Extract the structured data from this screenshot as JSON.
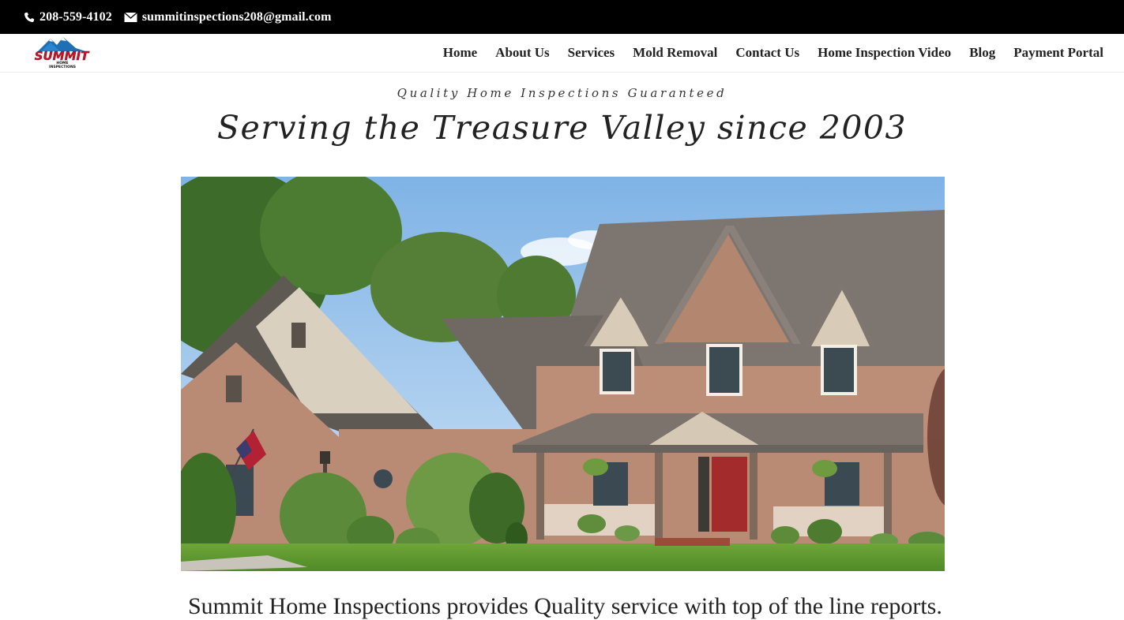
{
  "topbar": {
    "phone": "208-559-4102",
    "email": "summitinspections208@gmail.com",
    "phone_icon": "phone-icon",
    "email_icon": "envelope-icon",
    "background": "#000000"
  },
  "logo": {
    "text": "SUMMIT",
    "subtext": "HOME INSPECTIONS",
    "primary_color": "#c8102e",
    "mountain_color": "#1f6fb5"
  },
  "nav": {
    "items": [
      {
        "label": "Home"
      },
      {
        "label": "About Us"
      },
      {
        "label": "Services"
      },
      {
        "label": "Mold Removal"
      },
      {
        "label": "Contact Us"
      },
      {
        "label": "Home Inspection Video"
      },
      {
        "label": "Blog"
      },
      {
        "label": "Payment Portal"
      }
    ]
  },
  "hero": {
    "tagline": "Quality Home Inspections Guaranteed",
    "headline": "Serving the Treasure Valley since 2003"
  },
  "intro": {
    "text": "Summit Home Inspections provides Quality service with top of the line reports. W"
  }
}
